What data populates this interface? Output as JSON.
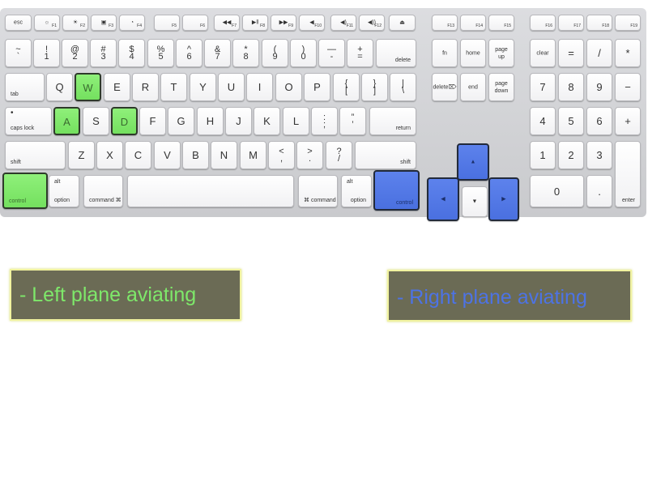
{
  "keyboard": {
    "fn_row": {
      "esc": "esc",
      "f1": "F1",
      "f2": "F2",
      "f3": "F3",
      "f4": "F4",
      "f5": "F5",
      "f6": "F6",
      "f7": "F7",
      "f8": "F8",
      "f9": "F9",
      "f10": "F10",
      "f11": "F11",
      "f12": "F12",
      "f13": "F13",
      "f14": "F14",
      "f15": "F15",
      "f16": "F16",
      "f17": "F17",
      "f18": "F18",
      "f19": "F19"
    },
    "number_row": {
      "k1": [
        "~",
        "`"
      ],
      "k2": [
        "!",
        "1"
      ],
      "k3": [
        "@",
        "2"
      ],
      "k4": [
        "#",
        "3"
      ],
      "k5": [
        "$",
        "4"
      ],
      "k6": [
        "%",
        "5"
      ],
      "k7": [
        "^",
        "6"
      ],
      "k8": [
        "&",
        "7"
      ],
      "k9": [
        "*",
        "8"
      ],
      "k10": [
        "(",
        "9"
      ],
      "k11": [
        ")",
        "0"
      ],
      "k12": [
        "—",
        "-"
      ],
      "k13": [
        "+",
        "="
      ],
      "delete": "delete"
    },
    "qwerty_row": {
      "tab": "tab",
      "q": "Q",
      "w": "W",
      "e": "E",
      "r": "R",
      "t": "T",
      "y": "Y",
      "u": "U",
      "i": "I",
      "o": "O",
      "p": "P",
      "lb": [
        "{",
        "["
      ],
      "rb": [
        "}",
        "]"
      ],
      "bs": [
        "|",
        "\\"
      ]
    },
    "home_row": {
      "caps": "caps lock",
      "caps_dot": "•",
      "a": "A",
      "s": "S",
      "d": "D",
      "f": "F",
      "g": "G",
      "h": "H",
      "j": "J",
      "k": "K",
      "l": "L",
      "semi": [
        ":",
        ";"
      ],
      "quote": [
        "”",
        "’"
      ],
      "return": "return"
    },
    "shift_row": {
      "lshift": "shift",
      "z": "Z",
      "x": "X",
      "c": "C",
      "v": "V",
      "b": "B",
      "n": "N",
      "m": "M",
      "comma": [
        "<",
        ","
      ],
      "period": [
        ">",
        "."
      ],
      "slash": [
        "?",
        "/"
      ],
      "rshift": "shift"
    },
    "bottom_row": {
      "lcontrol": "control",
      "loption": "option",
      "alt": "alt",
      "lcommand": "command ⌘",
      "rcommand": "⌘ command",
      "roption": "option",
      "rcontrol": "control"
    },
    "nav": {
      "fn": "fn",
      "home": "home",
      "pageup": "page up",
      "delete": "delete⌦",
      "end": "end",
      "pagedown": "page down"
    },
    "numpad": {
      "clear": "clear",
      "eq": "=",
      "div": "/",
      "mul": "*",
      "n7": "7",
      "n8": "8",
      "n9": "9",
      "minus": "−",
      "n4": "4",
      "n5": "5",
      "n6": "6",
      "plus": "+",
      "n1": "1",
      "n2": "2",
      "n3": "3",
      "n0": "0",
      "dot": ".",
      "enter": "enter"
    },
    "arrows": {
      "up": "▲",
      "down": "▼",
      "left": "◀",
      "right": "▶"
    },
    "colors": {
      "left_plane": "#7ee86a",
      "right_plane": "#4d73e4"
    }
  },
  "legend": {
    "left": "- Left plane aviating",
    "right": "- Right plane aviating"
  }
}
